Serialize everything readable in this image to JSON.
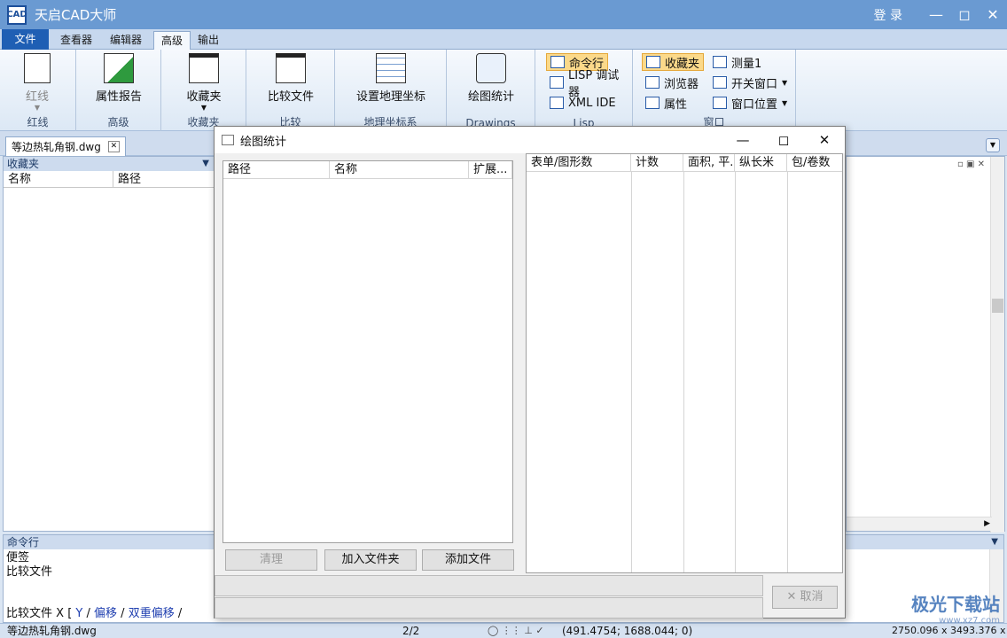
{
  "app": {
    "title": "天启CAD大师",
    "login": "登 录",
    "icon_text": "CAD"
  },
  "menu_tabs": [
    "文件",
    "查看器",
    "编辑器",
    "高级",
    "输出"
  ],
  "ribbon": {
    "redline": {
      "label": "红线",
      "group": "红线"
    },
    "property_report": {
      "label": "属性报告",
      "group": "高级"
    },
    "favorites": {
      "label": "收藏夹",
      "group": "收藏夹"
    },
    "compare": {
      "label": "比较文件",
      "group": "比较"
    },
    "geo": {
      "label": "设置地理坐标",
      "group": "地理坐标系"
    },
    "drawings": {
      "label": "绘图统计",
      "group": "Drawings"
    },
    "lisp": {
      "items": [
        "命令行",
        "LISP 调试器",
        "XML IDE"
      ],
      "group": "Lisp"
    },
    "window": {
      "col1": [
        "收藏夹",
        "浏览器",
        "属性"
      ],
      "col2": [
        "测量1",
        "开关窗口",
        "窗口位置"
      ],
      "group": "窗口"
    }
  },
  "doc_tab": "等边热轧角钢.dwg",
  "left_panel": {
    "title": "收藏夹",
    "columns": [
      "名称",
      "路径"
    ]
  },
  "dialog": {
    "title": "绘图统计",
    "left_columns": [
      "路径",
      "名称",
      "扩展..."
    ],
    "right_columns": [
      "表单/图形数",
      "计数",
      "面积, 平...",
      "纵长米",
      "包/卷数"
    ],
    "buttons": {
      "clear": "清理",
      "add_folder": "加入文件夹",
      "add_file": "添加文件",
      "cancel": "取消"
    }
  },
  "command_panel": {
    "title": "命令行",
    "lines": [
      "便签",
      "比较文件"
    ],
    "prompt": "比较文件",
    "options": [
      "X",
      "Y",
      "偏移",
      "双重偏移"
    ]
  },
  "status": {
    "file": "等边热轧角钢.dwg",
    "page": "2/2",
    "coords": "(491.4754; 1688.044; 0)",
    "size": "2750.096 x 3493.376 x 0"
  },
  "watermark": {
    "text": "极光下载站",
    "url": "www.xz7.com"
  }
}
